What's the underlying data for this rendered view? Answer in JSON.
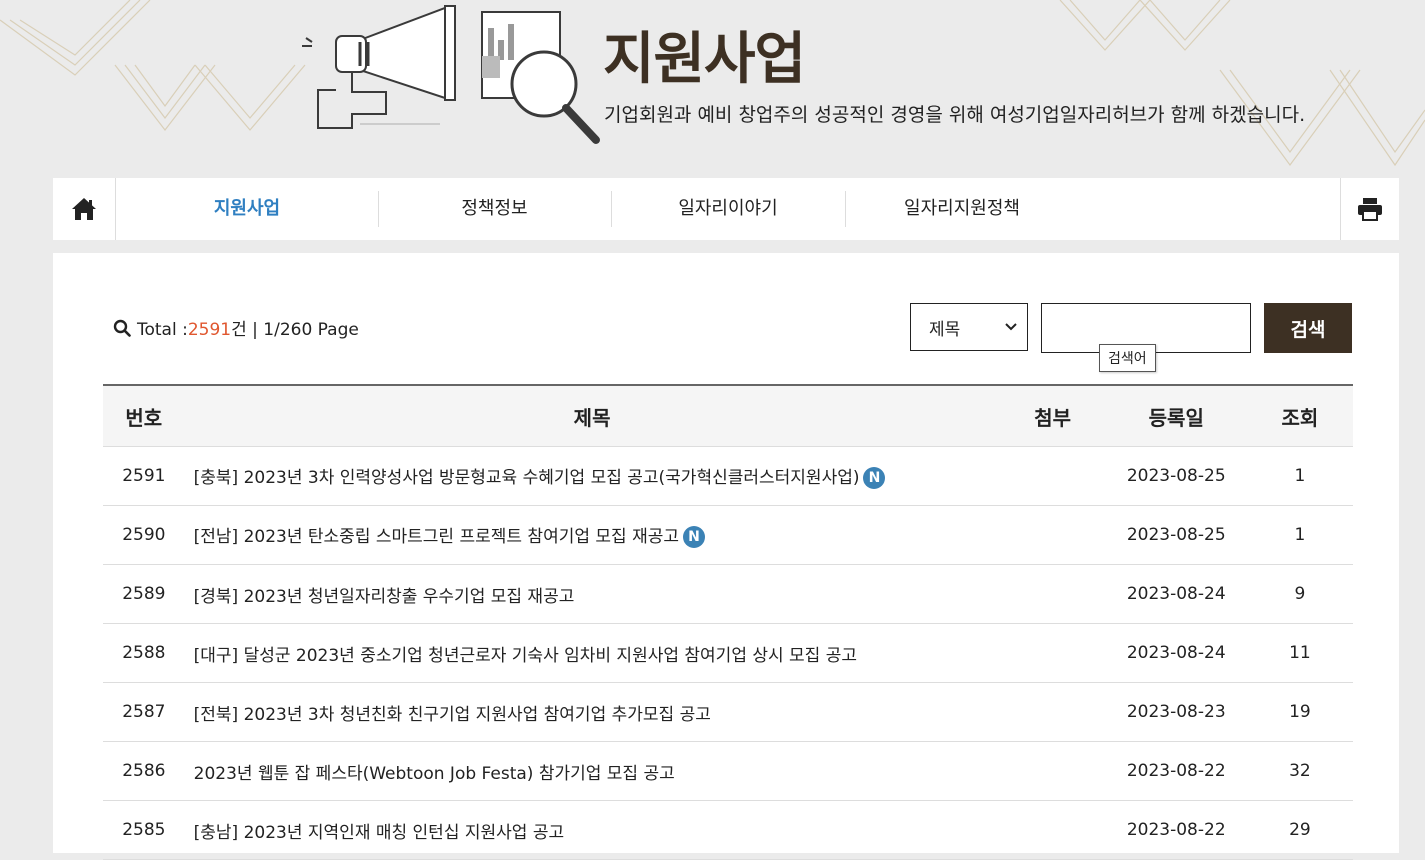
{
  "hero": {
    "title": "지원사업",
    "subtitle": "기업회원과 예비 창업주의 성공적인 경영을 위해 여성기업일자리허브가 함께 하겠습니다."
  },
  "nav": {
    "home_icon": "home-icon",
    "print_icon": "printer-icon",
    "tabs": [
      {
        "label": "지원사업",
        "active": true
      },
      {
        "label": "정책정보",
        "active": false
      },
      {
        "label": "일자리이야기",
        "active": false
      },
      {
        "label": "일자리지원정책",
        "active": false
      }
    ]
  },
  "summary": {
    "prefix": "Total :",
    "count": "2591",
    "unit": "건",
    "page": "| 1/260 Page"
  },
  "search": {
    "select_value": "제목",
    "input_value": "",
    "tooltip": "검색어",
    "button_label": "검색"
  },
  "table": {
    "headers": {
      "num": "번호",
      "title": "제목",
      "attach": "첨부",
      "date": "등록일",
      "views": "조회"
    },
    "new_badge": "N",
    "rows": [
      {
        "num": "2591",
        "title": "[충북] 2023년 3차 인력양성사업 방문형교육 수혜기업 모집 공고(국가혁신클러스터지원사업)",
        "date": "2023-08-25",
        "views": "1",
        "new": true
      },
      {
        "num": "2590",
        "title": "[전남] 2023년 탄소중립 스마트그린 프로젝트 참여기업 모집 재공고",
        "date": "2023-08-25",
        "views": "1",
        "new": true
      },
      {
        "num": "2589",
        "title": "[경북] 2023년 청년일자리창출 우수기업 모집 재공고",
        "date": "2023-08-24",
        "views": "9",
        "new": false
      },
      {
        "num": "2588",
        "title": "[대구] 달성군 2023년 중소기업 청년근로자 기숙사 임차비 지원사업 참여기업 상시 모집 공고",
        "date": "2023-08-24",
        "views": "11",
        "new": false
      },
      {
        "num": "2587",
        "title": "[전북] 2023년 3차 청년친화 친구기업 지원사업 참여기업 추가모집 공고",
        "date": "2023-08-23",
        "views": "19",
        "new": false
      },
      {
        "num": "2586",
        "title": "2023년 웹툰 잡 페스타(Webtoon Job Festa) 참가기업 모집 공고",
        "date": "2023-08-22",
        "views": "32",
        "new": false
      },
      {
        "num": "2585",
        "title": "[충남] 2023년 지역인재 매칭 인턴십 지원사업 공고",
        "date": "2023-08-22",
        "views": "29",
        "new": false
      }
    ]
  },
  "colors": {
    "brand_dark": "#3d3023",
    "active_tab": "#2f7fc1",
    "count": "#e0572f",
    "badge": "#3b82b5"
  }
}
